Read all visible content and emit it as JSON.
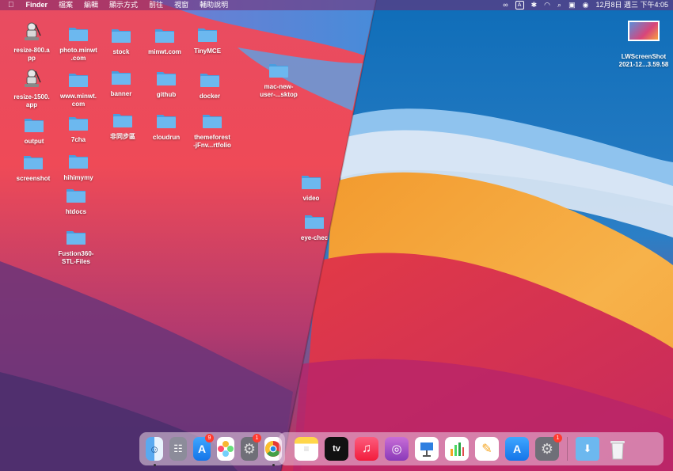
{
  "menubar": {
    "apple": "",
    "app_name": "Finder",
    "menus": [
      "檔案",
      "編輯",
      "顯示方式",
      "前往",
      "視窗",
      "輔助說明"
    ],
    "input_source": "A",
    "clock": "12月8日 週三 下午4:05"
  },
  "desktop": {
    "icons": [
      {
        "label": "resize-800.a\npp",
        "kind": "app"
      },
      {
        "label": "resize-1500.\napp",
        "kind": "app"
      },
      {
        "label": "output",
        "kind": "folder"
      },
      {
        "label": "screenshot",
        "kind": "folder"
      },
      {
        "label": "photo.minwt\n.com",
        "kind": "folder"
      },
      {
        "label": "www.minwt.\ncom",
        "kind": "folder"
      },
      {
        "label": "7cha",
        "kind": "folder"
      },
      {
        "label": "hihimymy",
        "kind": "folder"
      },
      {
        "label": "htdocs",
        "kind": "folder"
      },
      {
        "label": "Fustion360-\nSTL-Files",
        "kind": "folder"
      },
      {
        "label": "stock",
        "kind": "folder"
      },
      {
        "label": "banner",
        "kind": "folder"
      },
      {
        "label": "非同步區",
        "kind": "folder"
      },
      {
        "label": "minwt.com",
        "kind": "folder"
      },
      {
        "label": "github",
        "kind": "folder"
      },
      {
        "label": "cloudrun",
        "kind": "folder"
      },
      {
        "label": "TinyMCE",
        "kind": "folder"
      },
      {
        "label": "docker",
        "kind": "folder"
      },
      {
        "label": "themeforest\n-jFnv...rtfolio",
        "kind": "folder"
      },
      {
        "label": "mac-new-\nuser-...sktop",
        "kind": "folder"
      },
      {
        "label": "video",
        "kind": "folder"
      },
      {
        "label": "eye-chec",
        "kind": "folder"
      }
    ],
    "screenshot_file": {
      "label": "LWScreenShot\n2021-12...3.59.58"
    }
  },
  "dock_left": {
    "apps": [
      {
        "name": "finder",
        "badge": ""
      },
      {
        "name": "launchpad",
        "badge": ""
      },
      {
        "name": "app-store",
        "badge": "9"
      },
      {
        "name": "photos",
        "badge": ""
      },
      {
        "name": "system-preferences",
        "badge": "1"
      },
      {
        "name": "chrome",
        "badge": ""
      }
    ]
  },
  "dock_right": {
    "apps": [
      {
        "name": "notes",
        "badge": ""
      },
      {
        "name": "apple-tv",
        "badge": "",
        "text": "tv"
      },
      {
        "name": "music",
        "badge": ""
      },
      {
        "name": "podcasts",
        "badge": ""
      },
      {
        "name": "keynote",
        "badge": ""
      },
      {
        "name": "numbers",
        "badge": ""
      },
      {
        "name": "pages",
        "badge": ""
      },
      {
        "name": "app-store",
        "badge": ""
      },
      {
        "name": "system-preferences",
        "badge": "1"
      },
      {
        "name": "downloads",
        "badge": ""
      },
      {
        "name": "trash",
        "badge": ""
      }
    ]
  },
  "colors": {
    "folder": "#6cb8ef",
    "folder_dark": "#4a9ddf",
    "badge": "#ff3b30"
  }
}
